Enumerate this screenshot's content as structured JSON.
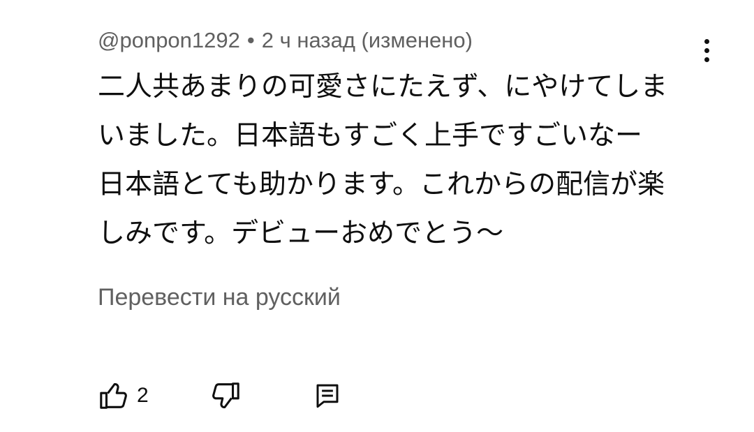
{
  "comment": {
    "author": "@ponpon1292",
    "separator": "•",
    "time": "2 ч назад (изменено)",
    "text_lines": [
      "二人共あまりの可愛さにたえず、にやけてしま",
      "いました。日本語もすごく上手ですごいなー",
      "日本語とても助かります。これからの配信が楽",
      "しみです。デビューおめでとう〜"
    ],
    "translate_label": "Перевести на русский",
    "like_count": "2"
  },
  "icons": {
    "menu": "more-vert-icon",
    "like": "thumbs-up-icon",
    "dislike": "thumbs-down-icon",
    "reply": "comment-icon"
  },
  "colors": {
    "text": "#0f0f0f",
    "secondary": "#606060",
    "background": "#ffffff"
  }
}
